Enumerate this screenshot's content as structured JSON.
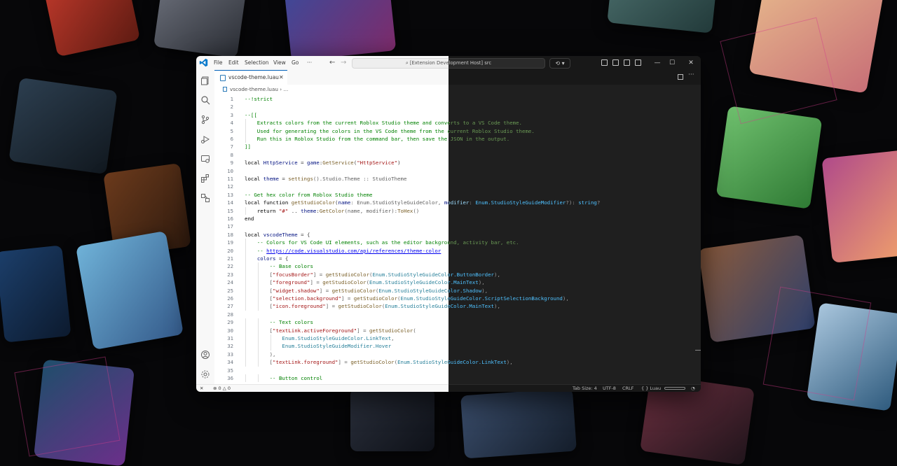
{
  "window": {
    "menu": [
      "File",
      "Edit",
      "Selection",
      "View",
      "Go",
      "···"
    ],
    "command_center": "[Extension Development Host] src",
    "window_controls": [
      "—",
      "☐",
      "✕"
    ]
  },
  "activity_bar": {
    "icons": [
      "explorer-icon",
      "search-icon",
      "source-control-icon",
      "run-debug-icon",
      "remote-explorer-icon",
      "extensions-icon",
      "testing-icon",
      "account-icon",
      "settings-gear-icon"
    ]
  },
  "tab": {
    "label": "vscode-theme.luau",
    "close": "✕"
  },
  "breadcrumb": {
    "file": "vscode-theme.luau",
    "sep": "›",
    "more": "..."
  },
  "editor": {
    "lines": [
      [
        {
          "t": "--!strict",
          "c": "comment"
        }
      ],
      [],
      [
        {
          "t": "--[[",
          "c": "comment"
        }
      ],
      [
        {
          "t": "    Extracts colors from the current Roblox Studio theme and converts to a VS Code theme.",
          "c": "comment"
        }
      ],
      [
        {
          "t": "    Used for generating the colors in the VS Code theme from the current Roblox Studio theme.",
          "c": "comment"
        }
      ],
      [
        {
          "t": "    Run this in Roblox Studio from the command bar, then save the JSON in the output.",
          "c": "comment"
        }
      ],
      [
        {
          "t": "]]",
          "c": "comment"
        }
      ],
      [],
      [
        {
          "t": "local",
          "c": "kw"
        },
        {
          "t": " HttpService ",
          "c": "var"
        },
        {
          "t": "=",
          "c": "op"
        },
        {
          "t": " game",
          "c": "var"
        },
        {
          "t": ":",
          "c": "op"
        },
        {
          "t": "GetService",
          "c": "fn"
        },
        {
          "t": "(",
          "c": "op"
        },
        {
          "t": "\"HttpService\"",
          "c": "str"
        },
        {
          "t": ")",
          "c": "op"
        }
      ],
      [],
      [
        {
          "t": "local",
          "c": "kw"
        },
        {
          "t": " theme ",
          "c": "var"
        },
        {
          "t": "=",
          "c": "op"
        },
        {
          "t": " settings",
          "c": "fn"
        },
        {
          "t": "().Studio.Theme :: StudioTheme",
          "c": "plain"
        }
      ],
      [],
      [
        {
          "t": "-- Get hex color from Roblox Studio theme",
          "c": "comment"
        }
      ],
      [
        {
          "t": "local",
          "c": "kw"
        },
        {
          "t": " function ",
          "c": "kw"
        },
        {
          "t": "getStudioColor",
          "c": "fn"
        },
        {
          "t": "(",
          "c": "op"
        },
        {
          "t": "name",
          "c": "var"
        },
        {
          "t": ": Enum.StudioStyleGuideColor, ",
          "c": "plain"
        },
        {
          "t": "modifier",
          "c": "var"
        },
        {
          "t": ": ",
          "c": "plain"
        },
        {
          "t": "Enum.StudioStyleGuideModifier",
          "c": "type"
        },
        {
          "t": "?): ",
          "c": "plain"
        },
        {
          "t": "string",
          "c": "type"
        },
        {
          "t": "?",
          "c": "plain"
        }
      ],
      [
        {
          "t": "    ",
          "c": "plain"
        },
        {
          "t": "return",
          "c": "kw"
        },
        {
          "t": " ",
          "c": "plain"
        },
        {
          "t": "\"#\"",
          "c": "str"
        },
        {
          "t": " .. ",
          "c": "op"
        },
        {
          "t": "theme",
          "c": "var"
        },
        {
          "t": ":",
          "c": "op"
        },
        {
          "t": "GetColor",
          "c": "fn"
        },
        {
          "t": "(name, modifier):",
          "c": "plain"
        },
        {
          "t": "ToHex",
          "c": "fn"
        },
        {
          "t": "()",
          "c": "plain"
        }
      ],
      [
        {
          "t": "end",
          "c": "kw"
        }
      ],
      [],
      [
        {
          "t": "local",
          "c": "kw"
        },
        {
          "t": " vscodeTheme ",
          "c": "var"
        },
        {
          "t": "= {",
          "c": "op"
        }
      ],
      [
        {
          "t": "    -- Colors for VS Code UI elements, such as the editor background, activity bar, etc.",
          "c": "comment"
        }
      ],
      [
        {
          "t": "    -- ",
          "c": "comment"
        },
        {
          "t": "https://code.visualstudio.com/api/references/theme-color",
          "c": "link"
        }
      ],
      [
        {
          "t": "    ",
          "c": "plain"
        },
        {
          "t": "colors",
          "c": "var"
        },
        {
          "t": " = {",
          "c": "op"
        }
      ],
      [
        {
          "t": "        -- Base colors",
          "c": "comment"
        }
      ],
      [
        {
          "t": "        [",
          "c": "plain"
        },
        {
          "t": "\"focusBorder\"",
          "c": "str"
        },
        {
          "t": "] = ",
          "c": "plain"
        },
        {
          "t": "getStudioColor",
          "c": "fn"
        },
        {
          "t": "(",
          "c": "plain"
        },
        {
          "t": "Enum.StudioStyleGuideColor.ButtonBorder",
          "c": "type"
        },
        {
          "t": "),",
          "c": "plain"
        }
      ],
      [
        {
          "t": "        [",
          "c": "plain"
        },
        {
          "t": "\"foreground\"",
          "c": "str"
        },
        {
          "t": "] = ",
          "c": "plain"
        },
        {
          "t": "getStudioColor",
          "c": "fn"
        },
        {
          "t": "(",
          "c": "plain"
        },
        {
          "t": "Enum.StudioStyleGuideColor.MainText",
          "c": "type"
        },
        {
          "t": "),",
          "c": "plain"
        }
      ],
      [
        {
          "t": "        [",
          "c": "plain"
        },
        {
          "t": "\"widget.shadow\"",
          "c": "str"
        },
        {
          "t": "] = ",
          "c": "plain"
        },
        {
          "t": "getStudioColor",
          "c": "fn"
        },
        {
          "t": "(",
          "c": "plain"
        },
        {
          "t": "Enum.StudioStyleGuideColor.Shadow",
          "c": "type"
        },
        {
          "t": "),",
          "c": "plain"
        }
      ],
      [
        {
          "t": "        [",
          "c": "plain"
        },
        {
          "t": "\"selection.background\"",
          "c": "str"
        },
        {
          "t": "] = ",
          "c": "plain"
        },
        {
          "t": "getStudioColor",
          "c": "fn"
        },
        {
          "t": "(",
          "c": "plain"
        },
        {
          "t": "Enum.StudioStyleGuideColor.ScriptSelectionBackground",
          "c": "type"
        },
        {
          "t": "),",
          "c": "plain"
        }
      ],
      [
        {
          "t": "        [",
          "c": "plain"
        },
        {
          "t": "\"icon.foreground\"",
          "c": "str"
        },
        {
          "t": "] = ",
          "c": "plain"
        },
        {
          "t": "getStudioColor",
          "c": "fn"
        },
        {
          "t": "(",
          "c": "plain"
        },
        {
          "t": "Enum.StudioStyleGuideColor.MainText",
          "c": "type"
        },
        {
          "t": "),",
          "c": "plain"
        }
      ],
      [],
      [
        {
          "t": "        -- Text colors",
          "c": "comment"
        }
      ],
      [
        {
          "t": "        [",
          "c": "plain"
        },
        {
          "t": "\"textLink.activeForeground\"",
          "c": "str"
        },
        {
          "t": "] = ",
          "c": "plain"
        },
        {
          "t": "getStudioColor",
          "c": "fn"
        },
        {
          "t": "(",
          "c": "plain"
        }
      ],
      [
        {
          "t": "            ",
          "c": "plain"
        },
        {
          "t": "Enum.StudioStyleGuideColor.LinkText",
          "c": "type"
        },
        {
          "t": ",",
          "c": "plain"
        }
      ],
      [
        {
          "t": "            ",
          "c": "plain"
        },
        {
          "t": "Enum.StudioStyleGuideModifier.Hover",
          "c": "type"
        }
      ],
      [
        {
          "t": "        ),",
          "c": "plain"
        }
      ],
      [
        {
          "t": "        [",
          "c": "plain"
        },
        {
          "t": "\"textLink.foreground\"",
          "c": "str"
        },
        {
          "t": "] = ",
          "c": "plain"
        },
        {
          "t": "getStudioColor",
          "c": "fn"
        },
        {
          "t": "(",
          "c": "plain"
        },
        {
          "t": "Enum.StudioStyleGuideColor.LinkText",
          "c": "type"
        },
        {
          "t": "),",
          "c": "plain"
        }
      ],
      [],
      [
        {
          "t": "        -- Button control",
          "c": "comment"
        }
      ]
    ]
  },
  "status_bar": {
    "errors": "0",
    "warnings": "0",
    "tab_size": "Tab Size: 4",
    "encoding": "UTF-8",
    "eol": "CRLF",
    "language": "Luau"
  },
  "themes": {
    "light": {
      "comment": "#008000",
      "kw": "#000000",
      "var": "#001080",
      "fn": "#795e26",
      "str": "#a31515",
      "op": "#3b3b3b",
      "plain": "#616161",
      "type": "#267f99",
      "link": "#0000ee"
    },
    "dark": {
      "comment": "#6a9955",
      "kw": "#cccccc",
      "var": "#9cdcfe",
      "fn": "#dcdcaa",
      "str": "#ce9178",
      "op": "#cccccc",
      "plain": "#9a9a9a",
      "type": "#4fc1ff",
      "link": "#3794ff"
    }
  }
}
